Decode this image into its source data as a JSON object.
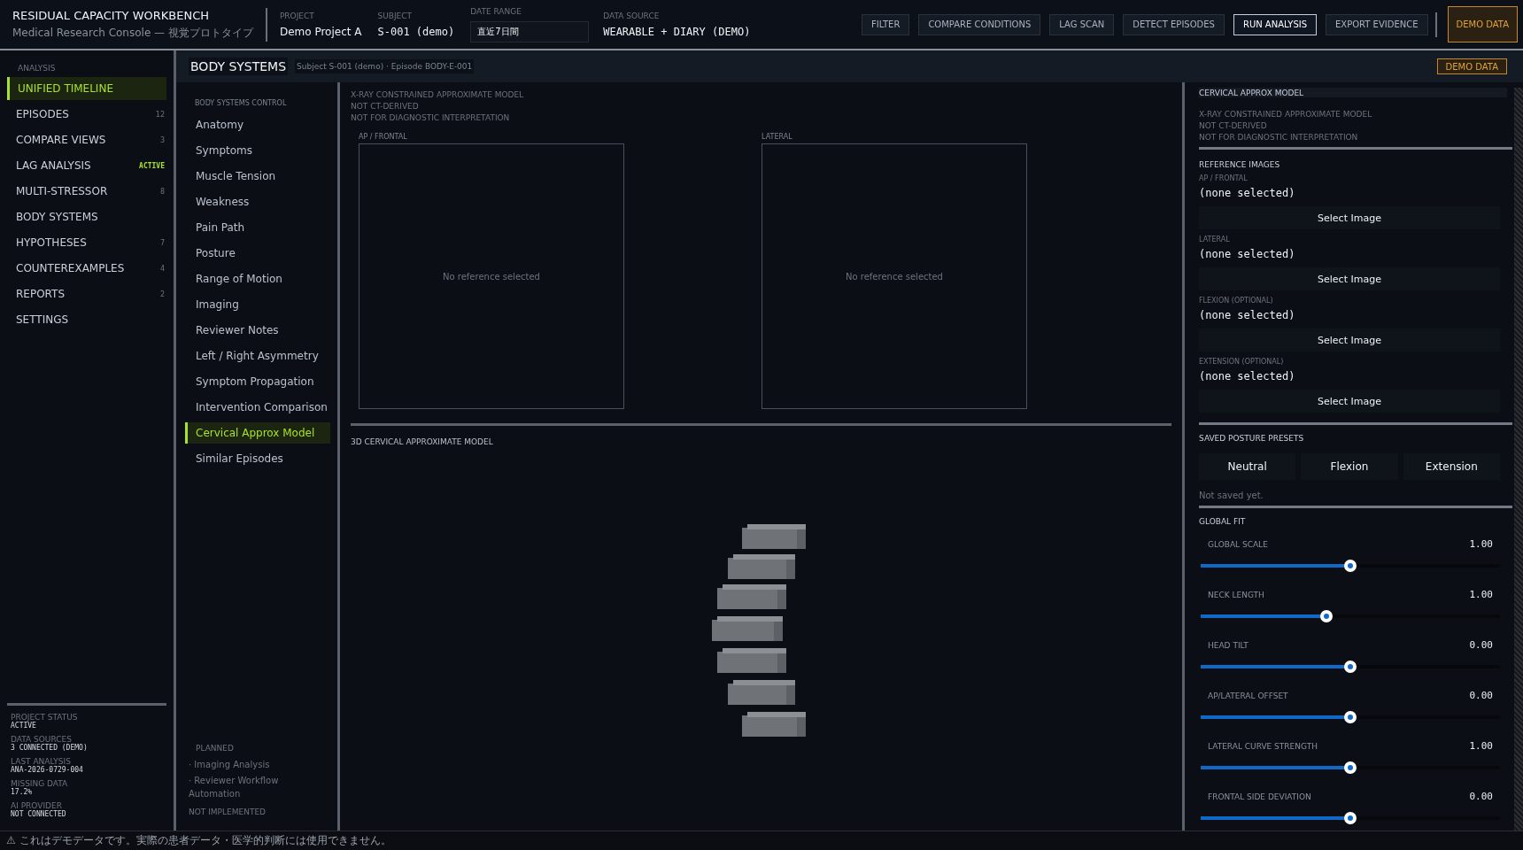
{
  "header": {
    "title": "RESIDUAL CAPACITY WORKBENCH",
    "subtitle": "Medical Research Console — 視覚プロトタイプ",
    "fields": [
      {
        "label": "PROJECT",
        "value": "Demo Project A",
        "kind": "text"
      },
      {
        "label": "SUBJECT",
        "value": "S-001 (demo)",
        "kind": "mono"
      },
      {
        "label": "DATE RANGE",
        "value": "直近7日間",
        "kind": "input"
      },
      {
        "label": "DATA SOURCE",
        "value": "WEARABLE + DIARY (DEMO)",
        "kind": "mono"
      }
    ],
    "buttons": [
      {
        "label": "FILTER",
        "selected": false
      },
      {
        "label": "COMPARE CONDITIONS",
        "selected": false
      },
      {
        "label": "LAG SCAN",
        "selected": false
      },
      {
        "label": "DETECT EPISODES",
        "selected": false
      },
      {
        "label": "RUN ANALYSIS",
        "selected": true
      },
      {
        "label": "EXPORT EVIDENCE",
        "selected": false
      }
    ],
    "badge": "DEMO DATA"
  },
  "sidebar": {
    "heading": "ANALYSIS",
    "items": [
      {
        "label": "UNIFIED TIMELINE",
        "selected": true
      },
      {
        "label": "EPISODES",
        "count": "12",
        "selected": false
      },
      {
        "label": "COMPARE VIEWS",
        "count": "3",
        "selected": false
      },
      {
        "label": "LAG ANALYSIS",
        "status": "ACTIVE",
        "selected": false
      },
      {
        "label": "MULTI-STRESSOR",
        "count": "8",
        "selected": false
      },
      {
        "label": "BODY SYSTEMS",
        "selected": false
      },
      {
        "label": "HYPOTHESES",
        "count": "7",
        "selected": false
      },
      {
        "label": "COUNTEREXAMPLES",
        "count": "4",
        "selected": false
      },
      {
        "label": "REPORTS",
        "count": "2",
        "selected": false
      },
      {
        "label": "SETTINGS",
        "selected": false
      }
    ],
    "status": [
      {
        "label": "PROJECT STATUS",
        "value": "ACTIVE"
      },
      {
        "label": "DATA SOURCES",
        "value": "3 CONNECTED (DEMO)"
      },
      {
        "label": "LAST ANALYSIS",
        "value": "ANA-2026-0729-004"
      },
      {
        "label": "MISSING DATA",
        "value": "17.2%"
      },
      {
        "label": "AI PROVIDER",
        "value": "NOT CONNECTED"
      }
    ]
  },
  "subheader": {
    "title": "BODY SYSTEMS",
    "subtitle": "Subject S-001 (demo) · Episode BODY-E-001",
    "badge": "DEMO DATA"
  },
  "control": {
    "heading": "BODY SYSTEMS CONTROL",
    "items": [
      {
        "label": "Anatomy",
        "selected": false
      },
      {
        "label": "Symptoms",
        "selected": false
      },
      {
        "label": "Muscle Tension",
        "selected": false
      },
      {
        "label": "Weakness",
        "selected": false
      },
      {
        "label": "Pain Path",
        "selected": false
      },
      {
        "label": "Posture",
        "selected": false
      },
      {
        "label": "Range of Motion",
        "selected": false
      },
      {
        "label": "Imaging",
        "selected": false
      },
      {
        "label": "Reviewer Notes",
        "selected": false
      },
      {
        "label": "Left / Right Asymmetry",
        "selected": false
      },
      {
        "label": "Symptom Propagation",
        "selected": false
      },
      {
        "label": "Intervention Comparison",
        "selected": false
      },
      {
        "label": "Cervical Approx Model",
        "selected": true
      },
      {
        "label": "Similar Episodes",
        "selected": false
      }
    ],
    "planned": {
      "heading": "PLANNED",
      "items": [
        "· Imaging Analysis",
        "· Reviewer Workflow Automation"
      ],
      "note": "NOT IMPLEMENTED"
    }
  },
  "center": {
    "notices": [
      "X-RAY CONSTRAINED APPROXIMATE MODEL",
      "NOT CT-DERIVED",
      "NOT FOR DIAGNOSTIC INTERPRETATION"
    ],
    "views": [
      {
        "label": "AP / FRONTAL",
        "message": "No reference selected"
      },
      {
        "label": "LATERAL",
        "message": "No reference selected"
      }
    ],
    "model_title": "3D CERVICAL APPROXIMATE MODEL"
  },
  "right": {
    "title": "CERVICAL APPROX MODEL",
    "notices": [
      "X-RAY CONSTRAINED APPROXIMATE MODEL",
      "NOT CT-DERIVED",
      "NOT FOR DIAGNOSTIC INTERPRETATION"
    ],
    "reference_heading": "REFERENCE IMAGES",
    "references": [
      {
        "label": "AP / FRONTAL",
        "value": "(none selected)",
        "button": "Select Image"
      },
      {
        "label": "LATERAL",
        "value": "(none selected)",
        "button": "Select Image"
      },
      {
        "label": "FLEXION (OPTIONAL)",
        "value": "(none selected)",
        "button": "Select Image"
      },
      {
        "label": "EXTENSION (OPTIONAL)",
        "value": "(none selected)",
        "button": "Select Image"
      }
    ],
    "presets_heading": "SAVED POSTURE PRESETS",
    "presets": [
      "Neutral",
      "Flexion",
      "Extension"
    ],
    "presets_note": "Not saved yet.",
    "fit_heading": "GLOBAL FIT",
    "sliders": [
      {
        "label": "GLOBAL SCALE",
        "reading": "1.00",
        "level": 0.5
      },
      {
        "label": "NECK LENGTH",
        "reading": "1.00",
        "level": 0.42
      },
      {
        "label": "HEAD TILT",
        "reading": "0.00",
        "level": 0.5
      },
      {
        "label": "AP/LATERAL OFFSET",
        "reading": "0.00",
        "level": 0.5
      },
      {
        "label": "LATERAL CURVE STRENGTH",
        "reading": "1.00",
        "level": 0.5
      },
      {
        "label": "FRONTAL SIDE DEVIATION",
        "reading": "0.00",
        "level": 0.5
      }
    ]
  },
  "footer": "⚠ これはデモデータです。実際の患者データ・医学的判断には使用できません。"
}
